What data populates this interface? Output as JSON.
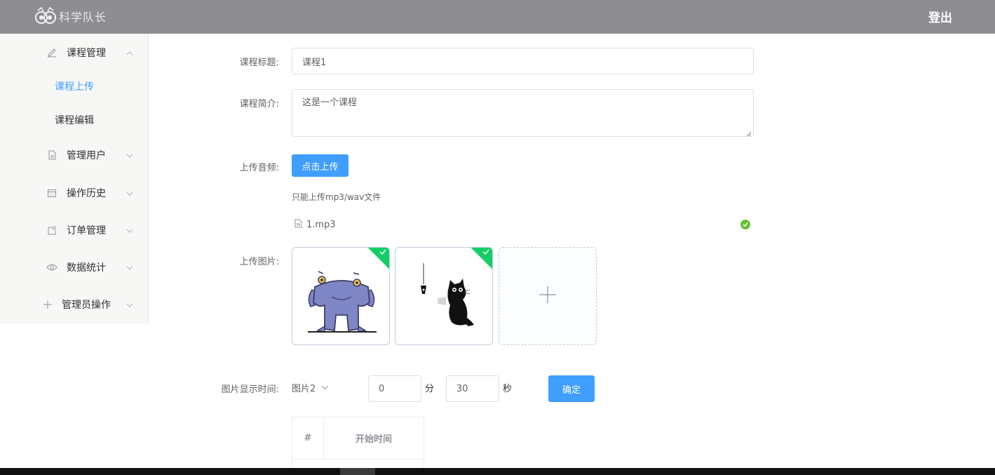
{
  "header": {
    "brand": "科学队长",
    "logout": "登出"
  },
  "sidebar": {
    "items": [
      {
        "label": "课程管理",
        "icon": "pencil-icon",
        "expanded": true
      },
      {
        "label": "管理用户",
        "icon": "document-icon",
        "expanded": false
      },
      {
        "label": "操作历史",
        "icon": "calendar-icon",
        "expanded": false
      },
      {
        "label": "订单管理",
        "icon": "tag-icon",
        "expanded": false
      },
      {
        "label": "数据统计",
        "icon": "eye-icon",
        "expanded": false
      },
      {
        "label": "管理员操作",
        "icon": "plus-icon",
        "expanded": false
      }
    ],
    "subitems": [
      {
        "label": "课程上传",
        "active": true
      },
      {
        "label": "课程编辑",
        "active": false
      }
    ]
  },
  "form": {
    "title_label": "课程标题:",
    "title_value": "课程1",
    "intro_label": "课程简介:",
    "intro_value": "这是一个课程",
    "audio_label": "上传音频:",
    "upload_button": "点击上传",
    "audio_tip": "只能上传mp3/wav文件",
    "audio_file": "1.mp3",
    "image_label": "上传图片:",
    "image_time_label": "图片显示时间:",
    "image_select": "图片2",
    "minutes_value": "0",
    "minutes_unit": "分",
    "seconds_value": "30",
    "seconds_unit": "秒",
    "confirm_button": "确定"
  },
  "table": {
    "headers": [
      "#",
      "开始时间"
    ]
  },
  "colors": {
    "header_bg": "#8e8e92",
    "primary": "#409eff",
    "success": "#67c23a",
    "upload_badge": "#13ce66"
  }
}
